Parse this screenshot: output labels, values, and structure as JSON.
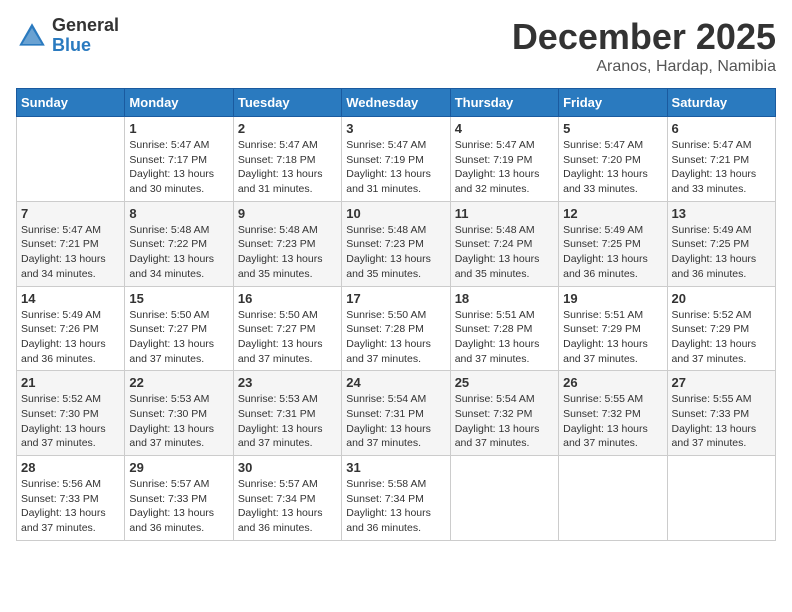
{
  "logo": {
    "general": "General",
    "blue": "Blue"
  },
  "title": "December 2025",
  "location": "Aranos, Hardap, Namibia",
  "days_of_week": [
    "Sunday",
    "Monday",
    "Tuesday",
    "Wednesday",
    "Thursday",
    "Friday",
    "Saturday"
  ],
  "weeks": [
    [
      {
        "day": "",
        "info": ""
      },
      {
        "day": "1",
        "info": "Sunrise: 5:47 AM\nSunset: 7:17 PM\nDaylight: 13 hours\nand 30 minutes."
      },
      {
        "day": "2",
        "info": "Sunrise: 5:47 AM\nSunset: 7:18 PM\nDaylight: 13 hours\nand 31 minutes."
      },
      {
        "day": "3",
        "info": "Sunrise: 5:47 AM\nSunset: 7:19 PM\nDaylight: 13 hours\nand 31 minutes."
      },
      {
        "day": "4",
        "info": "Sunrise: 5:47 AM\nSunset: 7:19 PM\nDaylight: 13 hours\nand 32 minutes."
      },
      {
        "day": "5",
        "info": "Sunrise: 5:47 AM\nSunset: 7:20 PM\nDaylight: 13 hours\nand 33 minutes."
      },
      {
        "day": "6",
        "info": "Sunrise: 5:47 AM\nSunset: 7:21 PM\nDaylight: 13 hours\nand 33 minutes."
      }
    ],
    [
      {
        "day": "7",
        "info": "Sunrise: 5:47 AM\nSunset: 7:21 PM\nDaylight: 13 hours\nand 34 minutes."
      },
      {
        "day": "8",
        "info": "Sunrise: 5:48 AM\nSunset: 7:22 PM\nDaylight: 13 hours\nand 34 minutes."
      },
      {
        "day": "9",
        "info": "Sunrise: 5:48 AM\nSunset: 7:23 PM\nDaylight: 13 hours\nand 35 minutes."
      },
      {
        "day": "10",
        "info": "Sunrise: 5:48 AM\nSunset: 7:23 PM\nDaylight: 13 hours\nand 35 minutes."
      },
      {
        "day": "11",
        "info": "Sunrise: 5:48 AM\nSunset: 7:24 PM\nDaylight: 13 hours\nand 35 minutes."
      },
      {
        "day": "12",
        "info": "Sunrise: 5:49 AM\nSunset: 7:25 PM\nDaylight: 13 hours\nand 36 minutes."
      },
      {
        "day": "13",
        "info": "Sunrise: 5:49 AM\nSunset: 7:25 PM\nDaylight: 13 hours\nand 36 minutes."
      }
    ],
    [
      {
        "day": "14",
        "info": "Sunrise: 5:49 AM\nSunset: 7:26 PM\nDaylight: 13 hours\nand 36 minutes."
      },
      {
        "day": "15",
        "info": "Sunrise: 5:50 AM\nSunset: 7:27 PM\nDaylight: 13 hours\nand 37 minutes."
      },
      {
        "day": "16",
        "info": "Sunrise: 5:50 AM\nSunset: 7:27 PM\nDaylight: 13 hours\nand 37 minutes."
      },
      {
        "day": "17",
        "info": "Sunrise: 5:50 AM\nSunset: 7:28 PM\nDaylight: 13 hours\nand 37 minutes."
      },
      {
        "day": "18",
        "info": "Sunrise: 5:51 AM\nSunset: 7:28 PM\nDaylight: 13 hours\nand 37 minutes."
      },
      {
        "day": "19",
        "info": "Sunrise: 5:51 AM\nSunset: 7:29 PM\nDaylight: 13 hours\nand 37 minutes."
      },
      {
        "day": "20",
        "info": "Sunrise: 5:52 AM\nSunset: 7:29 PM\nDaylight: 13 hours\nand 37 minutes."
      }
    ],
    [
      {
        "day": "21",
        "info": "Sunrise: 5:52 AM\nSunset: 7:30 PM\nDaylight: 13 hours\nand 37 minutes."
      },
      {
        "day": "22",
        "info": "Sunrise: 5:53 AM\nSunset: 7:30 PM\nDaylight: 13 hours\nand 37 minutes."
      },
      {
        "day": "23",
        "info": "Sunrise: 5:53 AM\nSunset: 7:31 PM\nDaylight: 13 hours\nand 37 minutes."
      },
      {
        "day": "24",
        "info": "Sunrise: 5:54 AM\nSunset: 7:31 PM\nDaylight: 13 hours\nand 37 minutes."
      },
      {
        "day": "25",
        "info": "Sunrise: 5:54 AM\nSunset: 7:32 PM\nDaylight: 13 hours\nand 37 minutes."
      },
      {
        "day": "26",
        "info": "Sunrise: 5:55 AM\nSunset: 7:32 PM\nDaylight: 13 hours\nand 37 minutes."
      },
      {
        "day": "27",
        "info": "Sunrise: 5:55 AM\nSunset: 7:33 PM\nDaylight: 13 hours\nand 37 minutes."
      }
    ],
    [
      {
        "day": "28",
        "info": "Sunrise: 5:56 AM\nSunset: 7:33 PM\nDaylight: 13 hours\nand 37 minutes."
      },
      {
        "day": "29",
        "info": "Sunrise: 5:57 AM\nSunset: 7:33 PM\nDaylight: 13 hours\nand 36 minutes."
      },
      {
        "day": "30",
        "info": "Sunrise: 5:57 AM\nSunset: 7:34 PM\nDaylight: 13 hours\nand 36 minutes."
      },
      {
        "day": "31",
        "info": "Sunrise: 5:58 AM\nSunset: 7:34 PM\nDaylight: 13 hours\nand 36 minutes."
      },
      {
        "day": "",
        "info": ""
      },
      {
        "day": "",
        "info": ""
      },
      {
        "day": "",
        "info": ""
      }
    ]
  ]
}
